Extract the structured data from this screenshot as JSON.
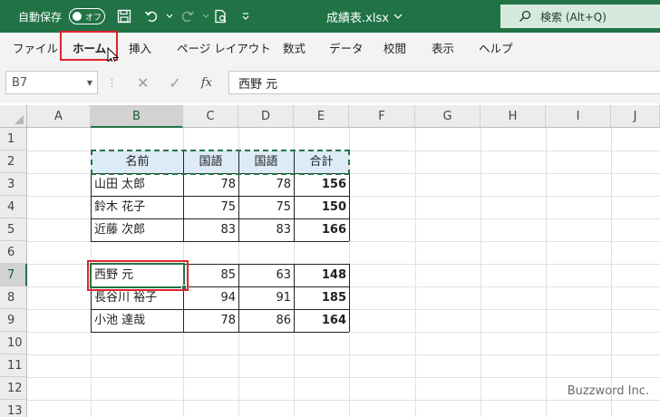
{
  "titlebar": {
    "autosave_label": "自動保存",
    "toggle_state": "オフ",
    "document_title": "成績表.xlsx",
    "search_label": "検索 (Alt+Q)",
    "bg_color": "#217346"
  },
  "ribbon": {
    "tabs": [
      "ファイル",
      "ホーム",
      "挿入",
      "ページ レイアウト",
      "数式",
      "データ",
      "校閲",
      "表示",
      "ヘルプ"
    ],
    "active_tab": "ホーム"
  },
  "formula_bar": {
    "name_box": "B7",
    "fx_label": "fx",
    "value": "西野 元"
  },
  "sheet": {
    "columns": [
      "A",
      "B",
      "C",
      "D",
      "E",
      "F",
      "G",
      "H",
      "I",
      "J"
    ],
    "rows": [
      "1",
      "2",
      "3",
      "4",
      "5",
      "6",
      "7",
      "8",
      "9",
      "10",
      "11",
      "12",
      "13"
    ],
    "selected_cell": "B7",
    "table_header": [
      "名前",
      "国語",
      "国語",
      "合計"
    ],
    "table1": [
      [
        "山田 太郎",
        "78",
        "78",
        "156"
      ],
      [
        "鈴木 花子",
        "75",
        "75",
        "150"
      ],
      [
        "近藤 次郎",
        "83",
        "83",
        "166"
      ]
    ],
    "table2": [
      [
        "西野 元",
        "85",
        "63",
        "148"
      ],
      [
        "長谷川 裕子",
        "94",
        "91",
        "185"
      ],
      [
        "小池 達哉",
        "78",
        "86",
        "164"
      ]
    ]
  },
  "watermark": "Buzzword Inc."
}
